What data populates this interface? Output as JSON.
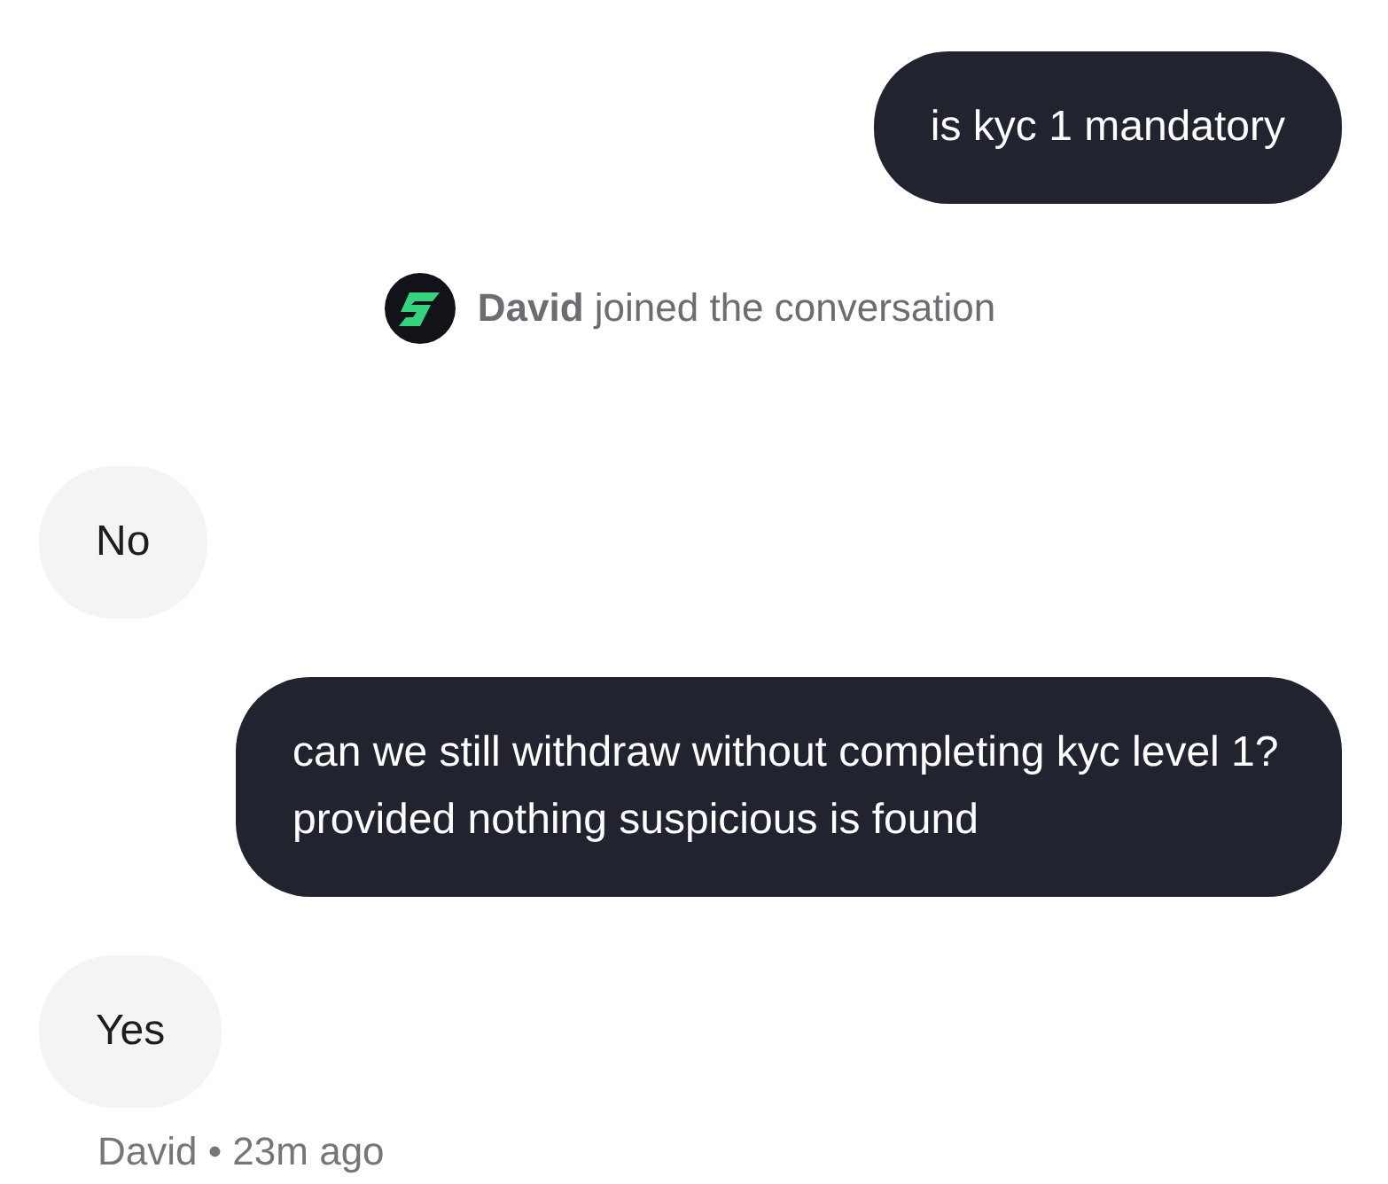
{
  "messages": [
    {
      "kind": "user",
      "text": "is kyc 1 mandatory"
    },
    {
      "kind": "event",
      "text": "**David** joined the conversation"
    },
    {
      "kind": "agent",
      "text": "No"
    },
    {
      "kind": "user",
      "text": "can we still withdraw without completing kyc level 1? provided nothing suspicious is found"
    },
    {
      "kind": "agent",
      "text": "Yes"
    }
  ],
  "footer": "David • 23m ago"
}
